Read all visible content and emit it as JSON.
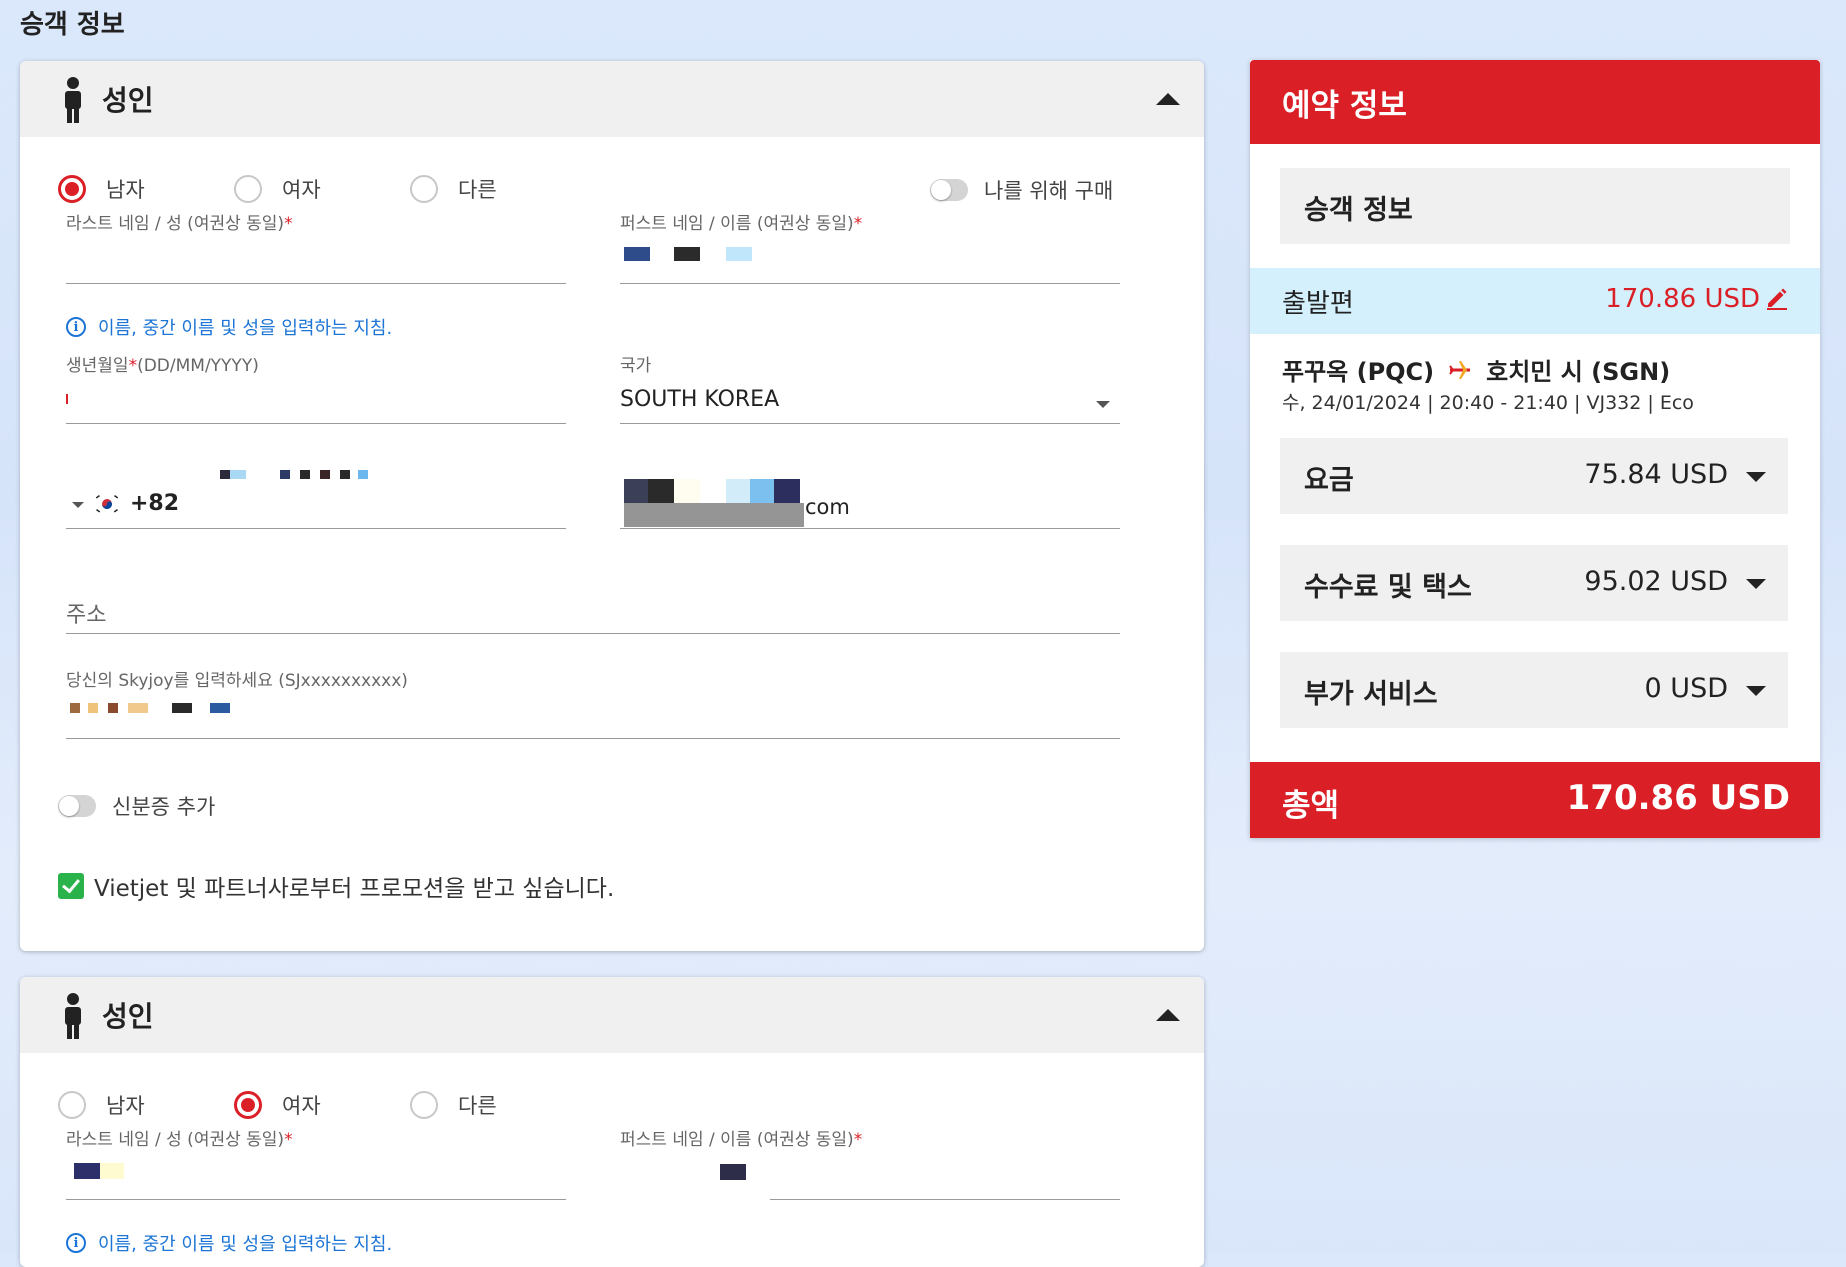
{
  "page": {
    "title": "승객 정보"
  },
  "passengers": [
    {
      "type_label": "성인",
      "gender_options": [
        "남자",
        "여자",
        "다른"
      ],
      "selected_gender": "남자",
      "buy_for_me_label": "나를 위해 구매",
      "last_name_label": "라스트 네임 / 성 (여권상 동일)",
      "first_name_label": "퍼스트 네임 / 이름 (여권상 동일)",
      "name_hint": "이름, 중간 이름 및 성을 입력하는 지침.",
      "dob_label": "생년월일",
      "dob_format": "(DD/MM/YYYY)",
      "country_label": "국가",
      "country_value": "SOUTH KOREA",
      "phone_code": "+82",
      "email_suffix": "com",
      "address_placeholder": "주소",
      "skyjoy_label": "당신의 Skyjoy를 입력하세요 (SJxxxxxxxxxx)",
      "id_toggle_label": "신분증 추가",
      "promo_label": "Vietjet 및 파트너사로부터 프로모션을 받고 싶습니다."
    },
    {
      "type_label": "성인",
      "gender_options": [
        "남자",
        "여자",
        "다른"
      ],
      "selected_gender": "여자",
      "last_name_label": "라스트 네임 / 성 (여권상 동일)",
      "first_name_label": "퍼스트 네임 / 이름 (여권상 동일)",
      "name_hint": "이름, 중간 이름 및 성을 입력하는 지침."
    }
  ],
  "booking": {
    "title": "예약 정보",
    "passenger_info_label": "승객 정보",
    "departure_label": "출발편",
    "departure_amount": "170.86 USD",
    "origin": "푸꾸옥 (PQC)",
    "destination": "호치민 시 (SGN)",
    "flight_detail": "수, 24/01/2024 | 20:40 - 21:40 | VJ332 | Eco",
    "fare_label": "요금",
    "fare_amount": "75.84 USD",
    "fees_label": "수수료 및 택스",
    "fees_amount": "95.02 USD",
    "addon_label": "부가 서비스",
    "addon_amount": "0 USD",
    "total_label": "총액",
    "total_amount": "170.86 USD"
  },
  "colors": {
    "brand_red": "#da1f26",
    "hint_blue": "#1c75d6",
    "check_green": "#2bb34b",
    "departure_bg": "#d4f0fd"
  },
  "icons": [
    "person-icon",
    "chevron-up-icon",
    "info-icon",
    "dropdown-arrow-icon",
    "korea-flag-icon",
    "checkbox-checked-icon",
    "edit-icon",
    "plane-icon"
  ]
}
